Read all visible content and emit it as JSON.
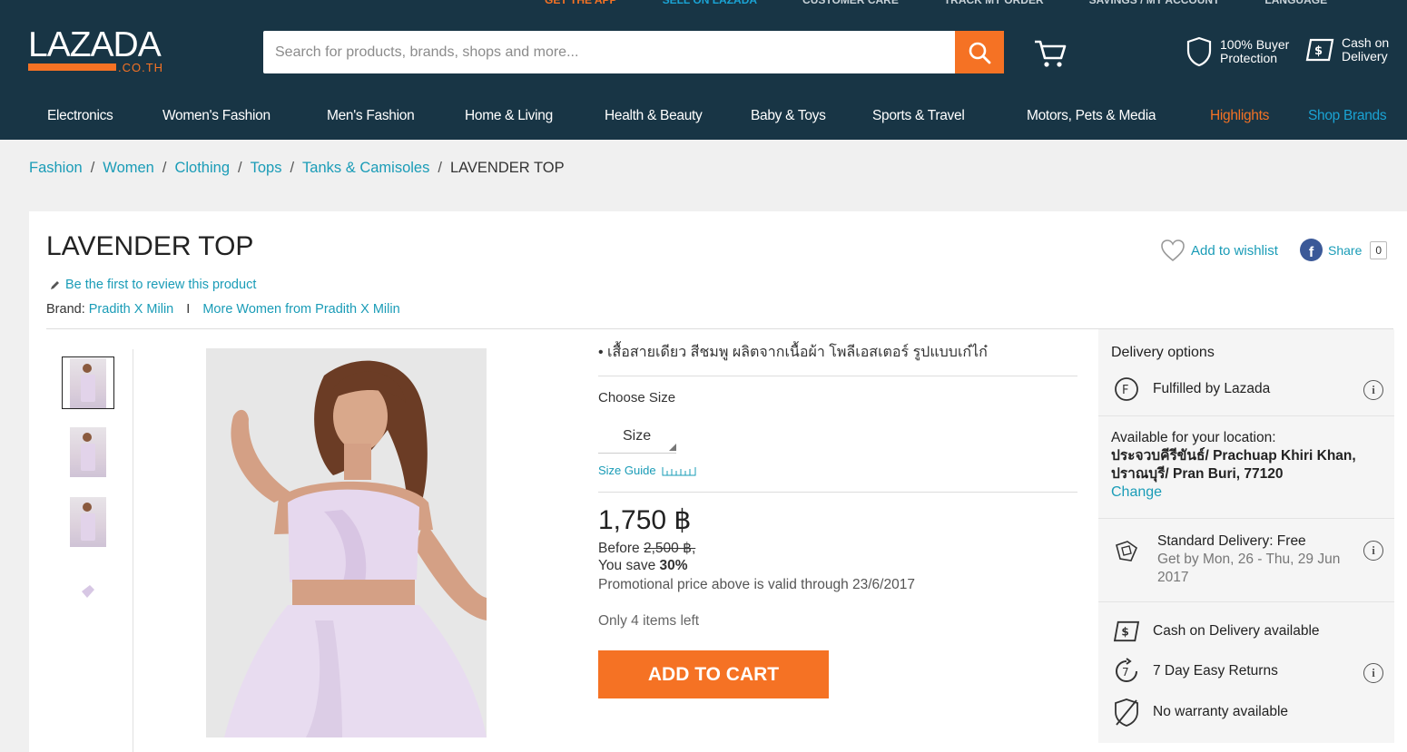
{
  "top_links": [
    {
      "label": "GET THE APP",
      "color": "#f57224"
    },
    {
      "label": "SELL ON LAZADA",
      "color": "#1aa3d4"
    },
    {
      "label": "CUSTOMER CARE",
      "color": "#c9d3d9"
    },
    {
      "label": "TRACK MY ORDER",
      "color": "#c9d3d9"
    },
    {
      "label": "SAVINGS / MY ACCOUNT",
      "color": "#c9d3d9"
    },
    {
      "label": "LANGUAGE",
      "color": "#c9d3d9"
    }
  ],
  "header": {
    "logo_text": "LAZADA",
    "logo_domain": ".CO.TH",
    "search_placeholder": "Search for products, brands, shops and more...",
    "buyer_protection": [
      "100% Buyer",
      "Protection"
    ],
    "cash_on_delivery": [
      "Cash on",
      "Delivery"
    ]
  },
  "nav": {
    "items": [
      "Electronics",
      "Women's Fashion",
      "Men's Fashion",
      "Home & Living",
      "Health & Beauty",
      "Baby & Toys",
      "Sports & Travel",
      "Motors, Pets & Media",
      "Highlights",
      "Shop Brands"
    ],
    "highlight_color": "#f57224",
    "brands_color": "#1aa3d4"
  },
  "breadcrumb": {
    "links": [
      "Fashion",
      "Women",
      "Clothing",
      "Tops",
      "Tanks & Camisoles"
    ],
    "current": "LAVENDER TOP",
    "separator": "/"
  },
  "product": {
    "title": "LAVENDER TOP",
    "review_link": "Be the first to review this product",
    "brand_label": "Brand:",
    "brand_name": "Pradith X Milin",
    "brand_pipe": "I",
    "more_from": "More Women from Pradith X Milin",
    "wishlist": "Add to wishlist",
    "share": "Share",
    "share_count": "0",
    "description": "• เสื้อสายเดียว สีชมพู ผลิตจากเนื้อผ้า     โพลีเอสเตอร์ รูปแบบเก๋ไก๋",
    "choose_size": "Choose Size",
    "size_value": "Size",
    "size_guide": "Size Guide",
    "price": "1,750 ฿",
    "before_label": "Before",
    "before_price": "2,500 ฿,",
    "save_label": "You save",
    "save_pct": "30%",
    "promo": "Promotional price above is valid through 23/6/2017",
    "stock": "Only 4 items left",
    "add_to_cart": "ADD TO CART",
    "accent": "#f57224",
    "link_color": "#1a9cb7"
  },
  "delivery": {
    "title": "Delivery options",
    "fulfilled": "Fulfilled by Lazada",
    "available_label": "Available for your location:",
    "location_line1": "ประจวบคีรีขันธ์/ Prachuap Khiri Khan,",
    "location_line2": "ปราณบุรี/ Pran Buri, 77120",
    "change": "Change",
    "standard": "Standard Delivery: Free",
    "standard_sub": "Get by Mon, 26 - Thu, 29 Jun 2017",
    "cod": "Cash on Delivery available",
    "returns": "7 Day Easy Returns",
    "warranty": "No warranty available",
    "info_glyph": "i"
  }
}
